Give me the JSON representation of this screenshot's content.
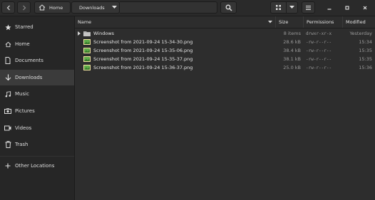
{
  "header": {
    "path": [
      {
        "label": "Home",
        "icon": "home-icon"
      },
      {
        "label": "Downloads",
        "icon": "chevron-down-icon"
      }
    ]
  },
  "sidebar": {
    "items": [
      {
        "label": "Starred",
        "icon": "star-icon"
      },
      {
        "label": "Home",
        "icon": "home-icon"
      },
      {
        "label": "Documents",
        "icon": "document-icon"
      },
      {
        "label": "Downloads",
        "icon": "download-icon",
        "active": true
      },
      {
        "label": "Music",
        "icon": "music-icon"
      },
      {
        "label": "Pictures",
        "icon": "camera-icon"
      },
      {
        "label": "Videos",
        "icon": "video-icon"
      },
      {
        "label": "Trash",
        "icon": "trash-icon"
      }
    ],
    "other_locations": {
      "label": "Other Locations",
      "icon": "plus-icon"
    }
  },
  "table": {
    "columns": {
      "name": "Name",
      "size": "Size",
      "permissions": "Permissions",
      "modified": "Modified"
    },
    "rows": [
      {
        "name": "Windows",
        "size": "8 items",
        "permissions": "drwxr-xr-x",
        "modified": "Yesterday",
        "type": "folder"
      },
      {
        "name": "Screenshot from 2021-09-24 15-34-30.png",
        "size": "28.6 kB",
        "permissions": "-rw-r--r--",
        "modified": "15:34",
        "type": "image"
      },
      {
        "name": "Screenshot from 2021-09-24 15-35-06.png",
        "size": "38.4 kB",
        "permissions": "-rw-r--r--",
        "modified": "15:35",
        "type": "image"
      },
      {
        "name": "Screenshot from 2021-09-24 15-35-37.png",
        "size": "38.1 kB",
        "permissions": "-rw-r--r--",
        "modified": "15:35",
        "type": "image"
      },
      {
        "name": "Screenshot from 2021-09-24 15-36-37.png",
        "size": "25.0 kB",
        "permissions": "-rw-r--r--",
        "modified": "15:36",
        "type": "image"
      }
    ]
  },
  "colors": {
    "background": "#2d2d2d",
    "sidebar": "#262626",
    "active": "#3b3b3b",
    "text": "#e6e6e6",
    "muted": "#9a9a9a"
  }
}
